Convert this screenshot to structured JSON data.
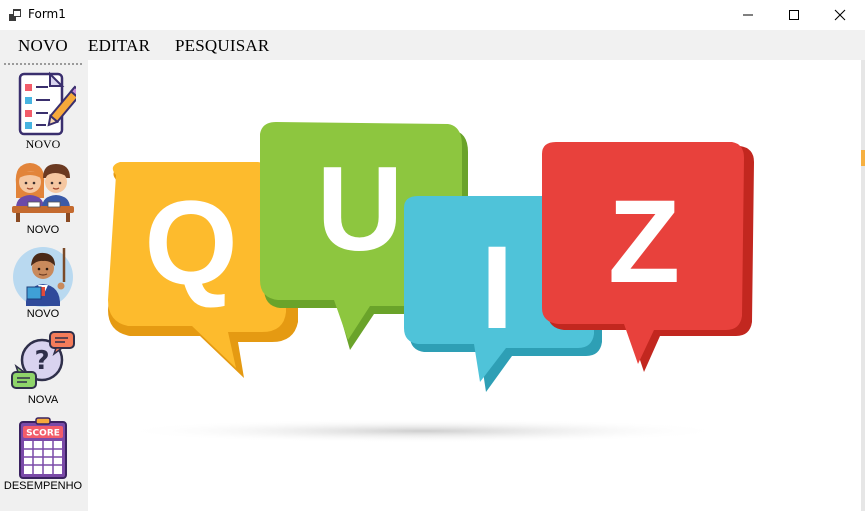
{
  "window": {
    "title": "Form1",
    "controls": [
      "minimize",
      "maximize",
      "close"
    ]
  },
  "menu": {
    "items": [
      "NOVO",
      "EDITAR",
      "PESQUISAR"
    ]
  },
  "toolbar": {
    "buttons": [
      {
        "label": "NOVO",
        "icon": "checklist-icon"
      },
      {
        "label": "NOVO",
        "icon": "students-icon"
      },
      {
        "label": "NOVO",
        "icon": "teacher-icon"
      },
      {
        "label": "NOVA",
        "icon": "question-chat-icon"
      },
      {
        "label": "DESEMPENHO",
        "icon": "score-board-icon"
      }
    ],
    "score_icon_text": "SCORE"
  },
  "banner": {
    "letters": [
      "Q",
      "U",
      "I",
      "Z"
    ],
    "colors": {
      "q": "#fdbb2d",
      "u": "#8dc63f",
      "i": "#4fc3d9",
      "z": "#e8413c"
    }
  }
}
